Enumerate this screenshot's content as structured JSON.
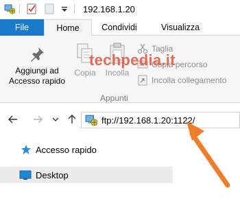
{
  "window": {
    "title": "192.168.1.20"
  },
  "quick_access_toolbar": {
    "icons": [
      "computer-network-icon",
      "properties-check-icon",
      "blank-page-icon",
      "dropdown-icon"
    ]
  },
  "ribbon_tabs": [
    {
      "label": "File",
      "active": false
    },
    {
      "label": "Home",
      "active": true
    },
    {
      "label": "Condividi",
      "active": false
    },
    {
      "label": "Visualizza",
      "active": false
    }
  ],
  "ribbon": {
    "pin_label": "Aggiungi ad Accesso rapido",
    "pin_label_line1": "Aggiungi ad",
    "pin_label_line2": "Accesso rapido",
    "copy_label": "Copia",
    "paste_label": "Incolla",
    "cut_label": "Taglia",
    "copy_path_label": "Copia percorso",
    "paste_link_label": "Incolla collegamento",
    "group_label": "Appunti"
  },
  "watermark": "techpedia.it",
  "navigation": {
    "address": "ftp://192.168.1.20:1122/"
  },
  "nav_pane": {
    "items": [
      {
        "label": "Accesso rapido",
        "icon": "star-icon",
        "selected": false
      },
      {
        "label": "Desktop",
        "icon": "desktop-icon",
        "selected": true
      }
    ]
  },
  "colors": {
    "file_tab": "#1979ca",
    "ribbon_bg": "#f5f6f7",
    "arrow": "#f07d2a",
    "watermark": "#e2553c",
    "selection": "#ececec"
  }
}
